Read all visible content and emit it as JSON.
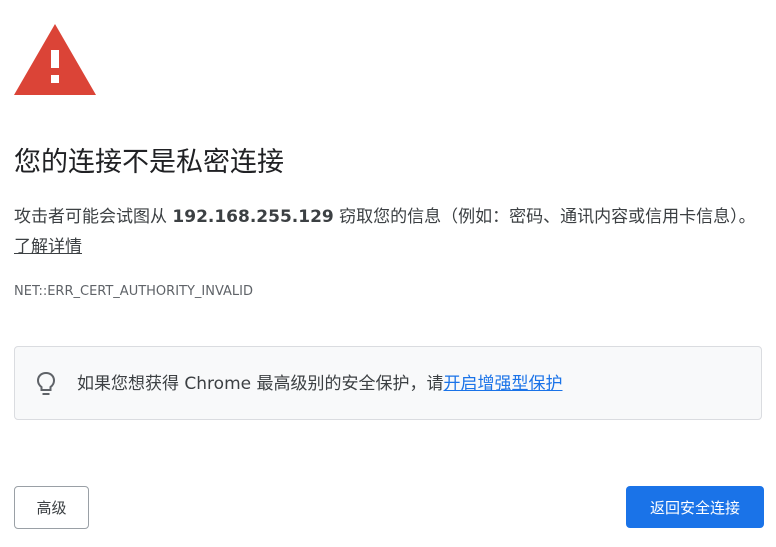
{
  "header": {
    "icon": "warning-triangle-icon",
    "icon_color": "#DB4437",
    "title": "您的连接不是私密连接"
  },
  "description": {
    "prefix": "攻击者可能会试图从 ",
    "host": "192.168.255.129",
    "suffix": " 窃取您的信息（例如：密码、通讯内容或信用卡信息）。",
    "learn_more": "了解详情"
  },
  "error_code": "NET::ERR_CERT_AUTHORITY_INVALID",
  "enhanced_protection": {
    "icon": "lightbulb-icon",
    "text": "如果您想获得 Chrome 最高级别的安全保护，请",
    "link": "开启增强型保护"
  },
  "buttons": {
    "advanced": "高级",
    "back_to_safety": "返回安全连接",
    "primary_color": "#1A73E8"
  }
}
